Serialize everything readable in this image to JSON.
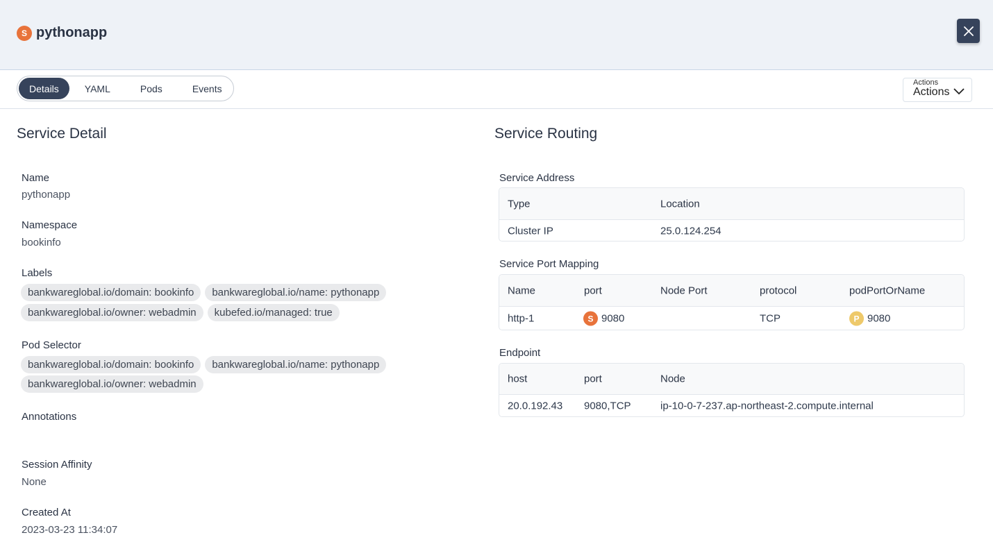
{
  "header": {
    "kind_badge": "S",
    "title": "pythonapp"
  },
  "tabs": [
    "Details",
    "YAML",
    "Pods",
    "Events"
  ],
  "actions": {
    "small_label": "Actions",
    "label": "Actions"
  },
  "service_detail": {
    "title": "Service Detail",
    "name_label": "Name",
    "name": "pythonapp",
    "namespace_label": "Namespace",
    "namespace": "bookinfo",
    "labels_label": "Labels",
    "labels": [
      "bankwareglobal.io/domain: bookinfo",
      "bankwareglobal.io/name: pythonapp",
      "bankwareglobal.io/owner: webadmin",
      "kubefed.io/managed: true"
    ],
    "pod_selector_label": "Pod Selector",
    "pod_selector": [
      "bankwareglobal.io/domain: bookinfo",
      "bankwareglobal.io/name: pythonapp",
      "bankwareglobal.io/owner: webadmin"
    ],
    "annotations_label": "Annotations",
    "session_affinity_label": "Session Affinity",
    "session_affinity": "None",
    "created_at_label": "Created At",
    "created_at": "2023-03-23 11:34:07"
  },
  "service_routing": {
    "title": "Service Routing",
    "address": {
      "title": "Service Address",
      "headers": [
        "Type",
        "Location"
      ],
      "row": [
        "Cluster IP",
        "25.0.124.254"
      ]
    },
    "port_mapping": {
      "title": "Service Port Mapping",
      "headers": [
        "Name",
        "port",
        "Node Port",
        "protocol",
        "podPortOrName"
      ],
      "row": {
        "name": "http-1",
        "port_badge": "S",
        "port": "9080",
        "node_port": "",
        "protocol": "TCP",
        "pod_port_badge": "P",
        "pod_port": "9080"
      }
    },
    "endpoint": {
      "title": "Endpoint",
      "headers": [
        "host",
        "port",
        "Node"
      ],
      "row": [
        "20.0.192.43",
        "9080,TCP",
        "ip-10-0-7-237.ap-northeast-2.compute.internal"
      ]
    }
  },
  "colors": {
    "header_bg": "#eef2f7",
    "accent_dark": "#36435b",
    "service_badge": "#e8733b",
    "pod_badge": "#eec96a",
    "chip_bg": "#e9eaec"
  }
}
